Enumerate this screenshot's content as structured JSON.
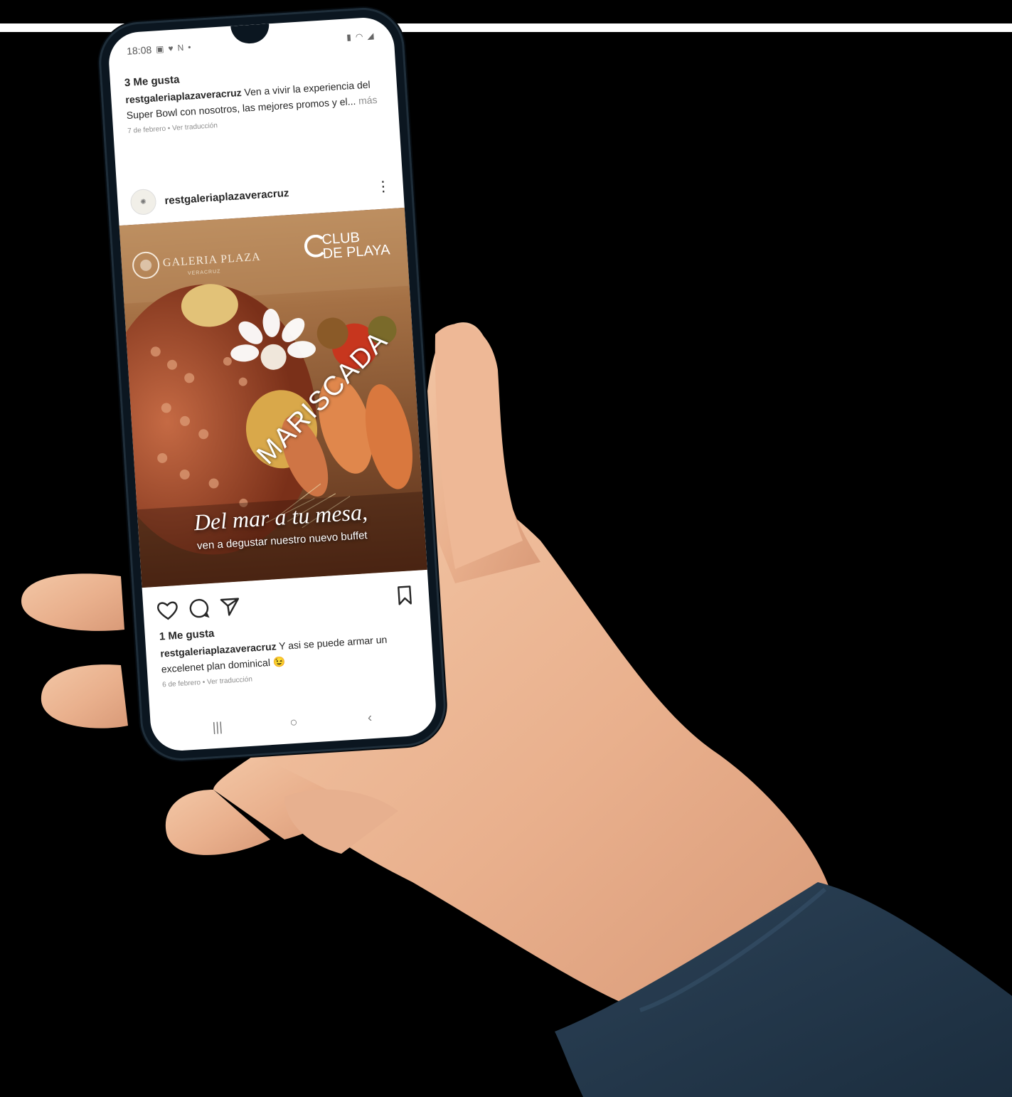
{
  "status_bar": {
    "time": "18:08",
    "left_icons": [
      "image-icon",
      "heart-icon",
      "n-icon"
    ],
    "right_icons": [
      "battery-icon",
      "wifi-icon",
      "signal-icon"
    ]
  },
  "previous_post": {
    "likes": "3 Me gusta",
    "username": "restgaleriaplazaveracruz",
    "caption": "Ven a vivir la experiencia del Super Bowl con nosotros, las mejores promos y el...",
    "more": "más",
    "meta": "7 de febrero • Ver traducción"
  },
  "post": {
    "username": "restgaleriaplazaveracruz",
    "menu_glyph": "⋮",
    "image": {
      "brand_left": "GALERIA PLAZA",
      "brand_left_sub": "VERACRUZ",
      "brand_right_line1": "CLUB",
      "brand_right_line2": "DE PLAYA",
      "title": "MARISCADA",
      "slogan": "Del mar a tu mesa,",
      "tagline": "ven a degustar nuestro nuevo buffet"
    },
    "likes": "1 Me gusta",
    "caption": "Y asi se puede armar un excelenet plan dominical",
    "emoji": "😉",
    "meta": "6 de febrero • Ver traducción"
  },
  "nav": {
    "recents": "|||",
    "home": "○",
    "back": "‹"
  },
  "colors": {
    "background": "#000000",
    "phone_frame": "#0b1620",
    "text": "#262626",
    "muted": "#8e8e8e"
  }
}
